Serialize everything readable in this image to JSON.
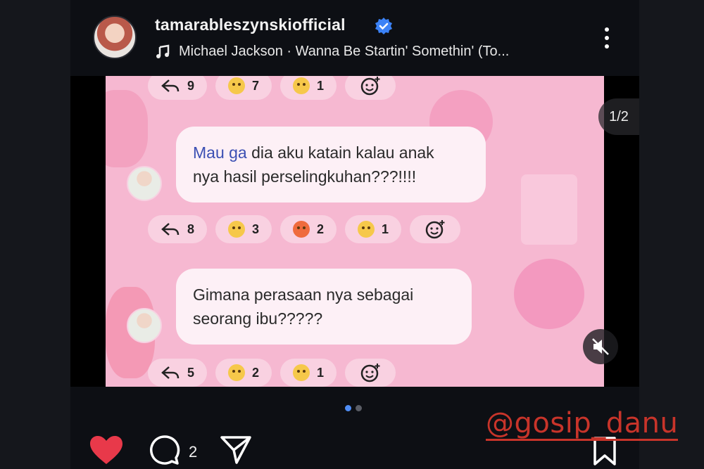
{
  "header": {
    "username": "tamarableszynskiofficial",
    "verified_icon": "verified-badge-icon",
    "music_text": "Michael Jackson · Wanna Be Startin' Somethin' (To...",
    "more_icon": "more-vertical-icon"
  },
  "media": {
    "counter": "1/2",
    "top_row": {
      "replies": "9",
      "reactions": [
        "7",
        "1"
      ]
    },
    "comment1": {
      "lead": "Mau ga",
      "text_line1": " dia aku katain kalau anak",
      "text_line2": "nya hasil perselingkuhan???!!!!"
    },
    "row1": {
      "replies": "8",
      "reactions": [
        "3",
        "2",
        "1"
      ]
    },
    "comment2": {
      "line1": "Gimana perasaan nya sebagai",
      "line2": "seorang ibu?????"
    },
    "row2": {
      "replies": "5",
      "reactions": [
        "2",
        "1"
      ]
    }
  },
  "actions": {
    "comment_count": "2"
  },
  "watermark": "@gosip_danu",
  "colors": {
    "accent_blue": "#4f8df5",
    "like_red": "#e8394a",
    "bubble_bg": "#fdf0f6",
    "pink_bg": "#f6b8d1"
  }
}
